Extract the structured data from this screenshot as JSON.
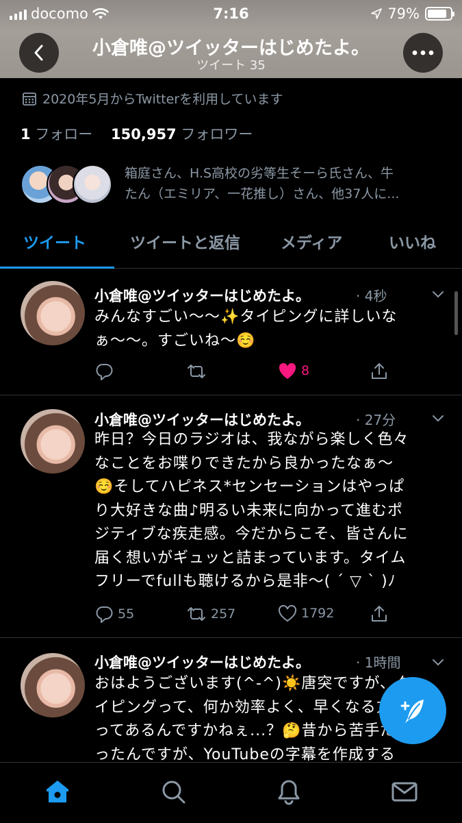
{
  "status_bar": {
    "carrier": "docomo",
    "time": "7:16",
    "battery": "79%"
  },
  "header": {
    "title": "小倉唯@ツイッターはじめたよ。",
    "subtitle": "ツイート 35"
  },
  "profile": {
    "joined": "2020年5月からTwitterを利用しています",
    "following_count": "1",
    "following_label": "フォロー",
    "followers_count": "150,957",
    "followers_label": "フォロワー",
    "followed_by_line1": "箱庭さん、H.S高校の劣等生そーら氏さん、牛",
    "followed_by_line2": "たん（エミリア、一花推し）さん、他37人に..."
  },
  "tabs": [
    "ツイート",
    "ツイートと返信",
    "メディア",
    "いいね"
  ],
  "tweets": [
    {
      "name": "小倉唯@ツイッターはじめたよ。",
      "time": "· 4秒",
      "lines": [
        "みんなすごい〜〜✨タイピングに詳しいな",
        "ぁ〜〜。すごいね〜☺️"
      ],
      "replies": "",
      "retweets": "",
      "likes": "8"
    },
    {
      "name": "小倉唯@ツイッターはじめたよ。",
      "time": "· 27分",
      "lines": [
        "昨日？今日のラジオは、我ながら楽しく色々",
        "なことをお喋りできたから良かったなぁ〜",
        "☺️そしてハピネス*センセーションはやっぱ",
        "り大好きな曲♪明るい未来に向かって進むポ",
        "ジティブな疾走感。今だからこそ、皆さんに",
        "届く想いがギュッと詰まっています。タイム",
        "フリーでfullも聴けるから是非〜( ´ ▽ ` )ﾉ"
      ],
      "replies": "55",
      "retweets": "257",
      "likes": "1792"
    },
    {
      "name": "小倉唯@ツイッターはじめたよ。",
      "time": "· 1時間",
      "lines": [
        "おはようございます(^-^)☀️唐突ですが、タ",
        "イピングって、何か効率よく、早くなる方法",
        "ってあるんですかねぇ...？🤔昔から苦手だ",
        "ったんですが、YouTubeの字幕を作成する"
      ]
    }
  ],
  "colors": {
    "accent": "#1d9bf0",
    "like": "#f91880",
    "muted": "#8b98a5",
    "divider": "#2f3336"
  },
  "icons": {
    "back": "chevron-left-icon",
    "more": "more-icon",
    "calendar": "calendar-icon",
    "reply": "reply-icon",
    "retweet": "retweet-icon",
    "like": "heart-icon",
    "share": "share-icon",
    "compose": "compose-tweet-icon",
    "home": "home-icon",
    "search": "search-icon",
    "notifications": "bell-icon",
    "messages": "mail-icon"
  }
}
